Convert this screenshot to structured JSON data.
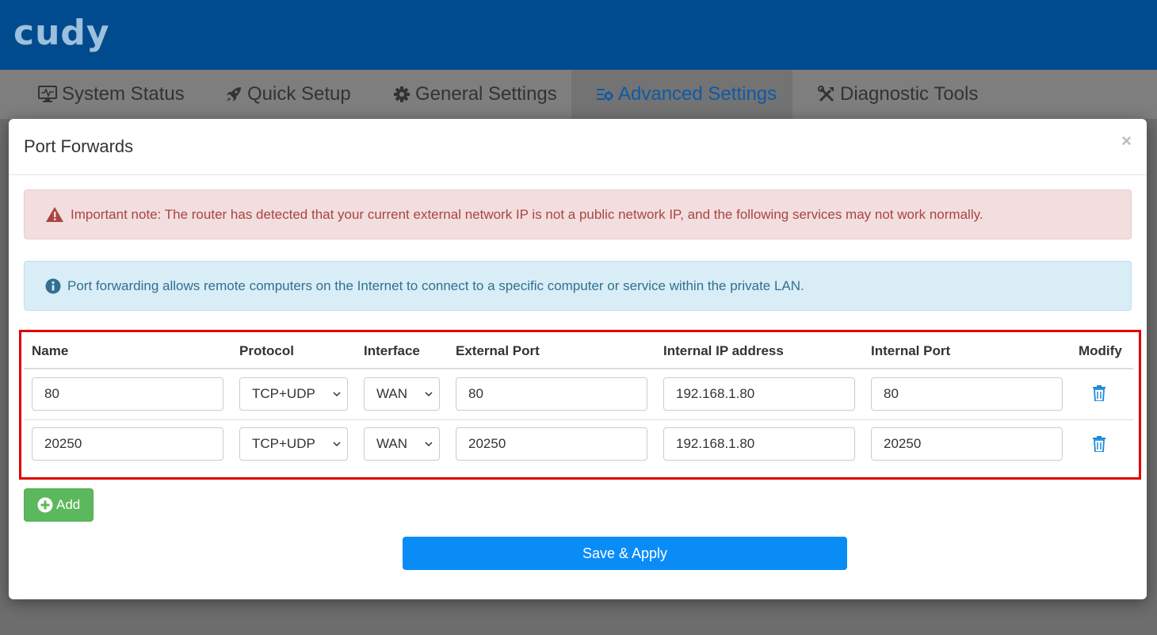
{
  "app": {
    "logo": "cudy"
  },
  "nav": {
    "items": [
      {
        "label": "System Status",
        "icon": "monitor-icon"
      },
      {
        "label": "Quick Setup",
        "icon": "rocket-icon"
      },
      {
        "label": "General Settings",
        "icon": "gear-icon"
      },
      {
        "label": "Advanced Settings",
        "icon": "advanced-settings-icon",
        "active": true
      },
      {
        "label": "Diagnostic Tools",
        "icon": "tools-icon"
      }
    ]
  },
  "modal": {
    "title": "Port Forwards",
    "close": "×",
    "warning": "Important note: The router has detected that your current external network IP is not a public network IP, and the following services may not work normally.",
    "info": "Port forwarding allows remote computers on the Internet to connect to a specific computer or service within the private LAN."
  },
  "table": {
    "headers": {
      "name": "Name",
      "protocol": "Protocol",
      "interface": "Interface",
      "external_port": "External Port",
      "internal_ip": "Internal IP address",
      "internal_port": "Internal Port",
      "modify": "Modify"
    },
    "rows": [
      {
        "name": "80",
        "protocol": "TCP+UDP",
        "interface": "WAN",
        "external_port": "80",
        "internal_ip": "192.168.1.80",
        "internal_port": "80"
      },
      {
        "name": "20250",
        "protocol": "TCP+UDP",
        "interface": "WAN",
        "external_port": "20250",
        "internal_ip": "192.168.1.80",
        "internal_port": "20250"
      }
    ]
  },
  "buttons": {
    "add": "Add",
    "save": "Save & Apply"
  },
  "colors": {
    "header_bg": "#004b8d",
    "active_tab_text": "#0e5aa5",
    "danger_text": "#a94442",
    "info_text": "#31708f",
    "highlight_border": "#e00000",
    "add_button": "#5cb85c",
    "save_button": "#0a8cf7",
    "trash_icon": "#1a88dc"
  }
}
